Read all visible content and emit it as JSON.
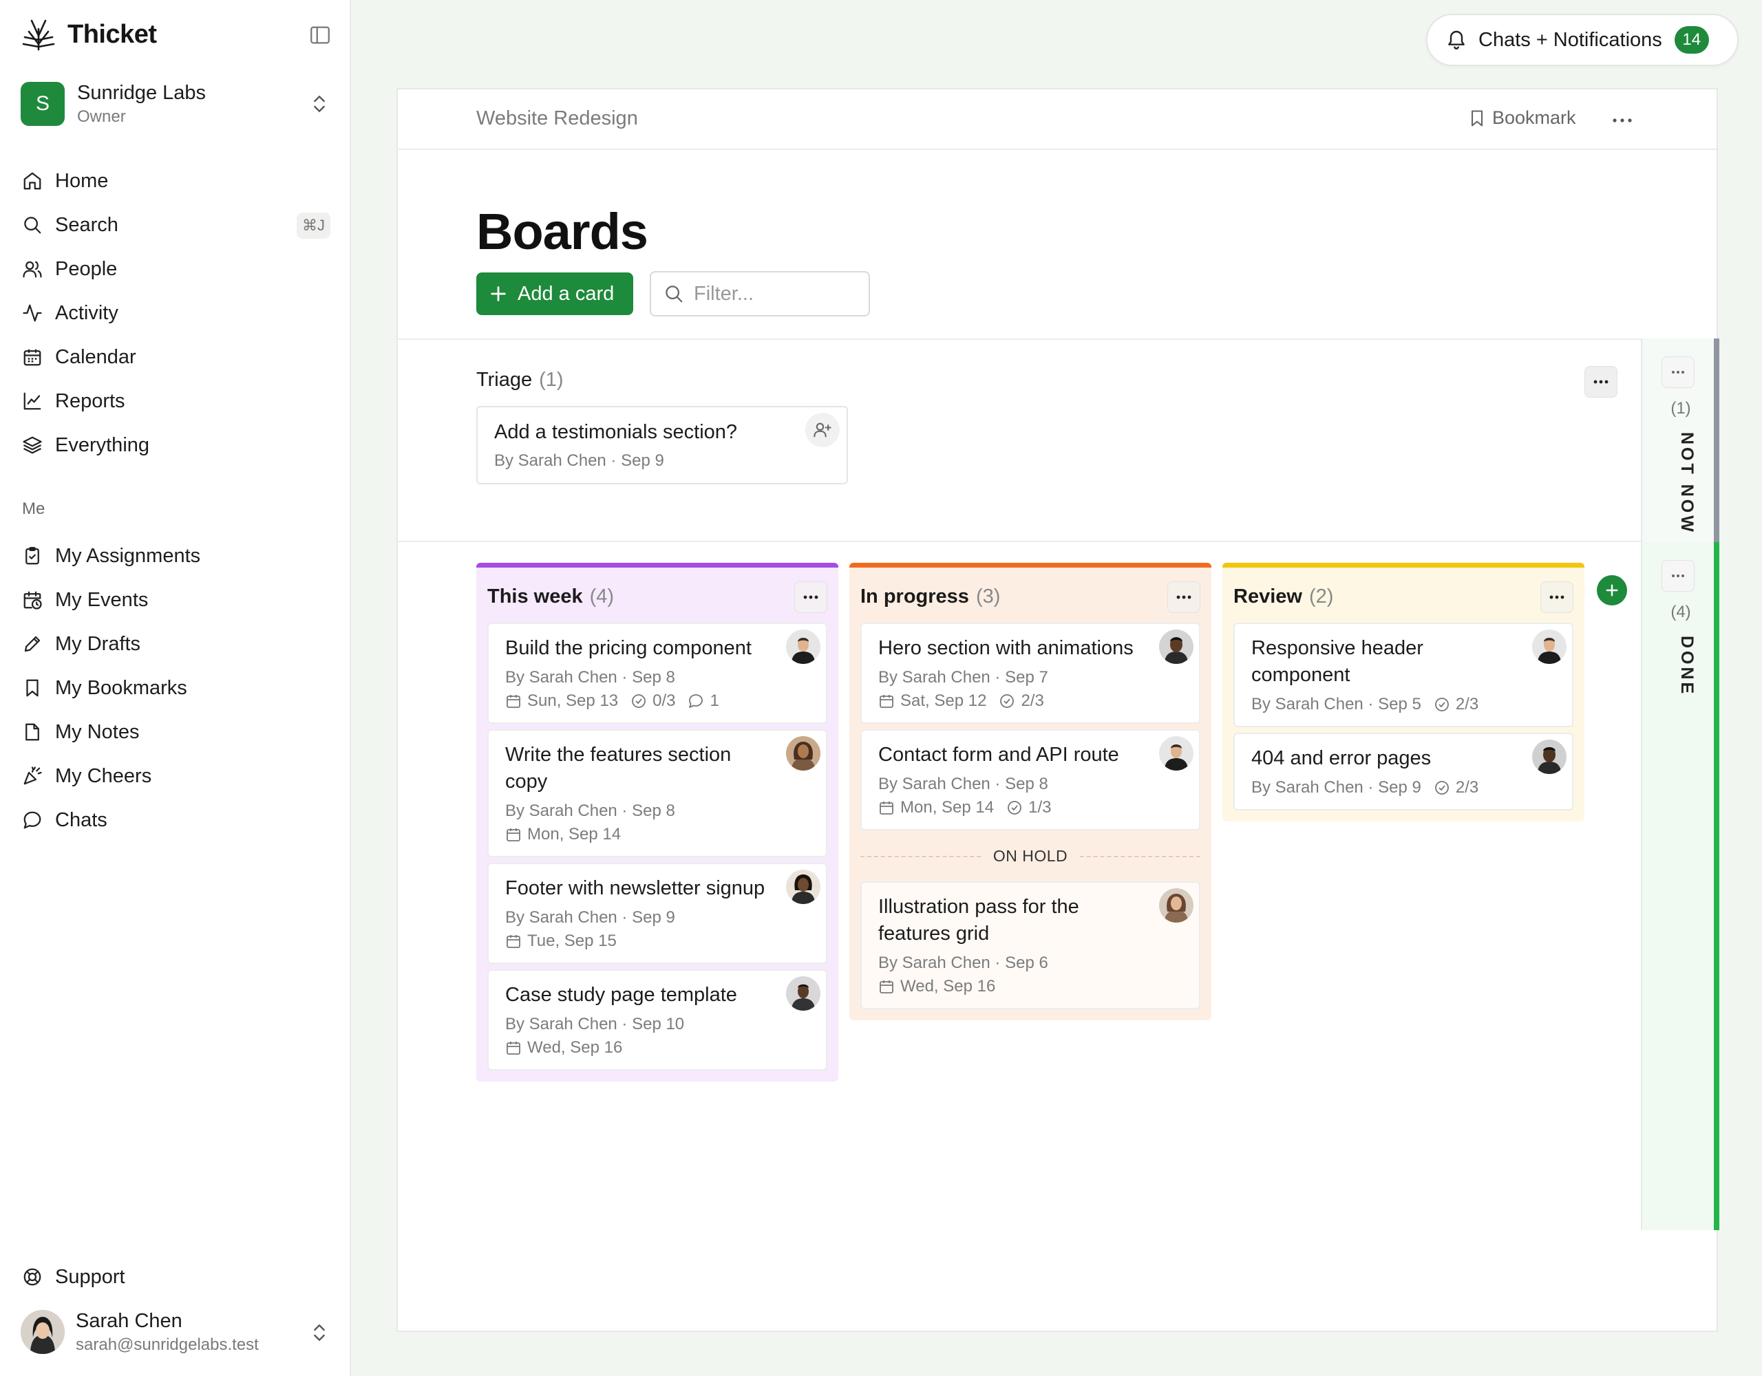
{
  "app": {
    "name": "Thicket"
  },
  "org": {
    "name": "Sunridge Labs",
    "role": "Owner",
    "initial": "S"
  },
  "nav": {
    "main": [
      {
        "label": "Home",
        "icon": "home-icon"
      },
      {
        "label": "Search",
        "icon": "search-icon",
        "shortcut": "⌘J"
      },
      {
        "label": "People",
        "icon": "people-icon"
      },
      {
        "label": "Activity",
        "icon": "activity-icon"
      },
      {
        "label": "Calendar",
        "icon": "calendar-icon"
      },
      {
        "label": "Reports",
        "icon": "chart-icon"
      },
      {
        "label": "Everything",
        "icon": "layers-icon"
      }
    ],
    "me_label": "Me",
    "me": [
      {
        "label": "My Assignments",
        "icon": "clipboard-check-icon"
      },
      {
        "label": "My Events",
        "icon": "calendar-clock-icon"
      },
      {
        "label": "My Drafts",
        "icon": "pencil-icon"
      },
      {
        "label": "My Bookmarks",
        "icon": "bookmark-icon"
      },
      {
        "label": "My Notes",
        "icon": "note-icon"
      },
      {
        "label": "My Cheers",
        "icon": "party-icon"
      },
      {
        "label": "Chats",
        "icon": "chat-icon"
      }
    ],
    "support": "Support"
  },
  "user": {
    "name": "Sarah Chen",
    "email": "sarah@sunridgelabs.test"
  },
  "notifications": {
    "label": "Chats + Notifications",
    "count": "14"
  },
  "header": {
    "breadcrumb": "Website Redesign",
    "bookmark_label": "Bookmark"
  },
  "page": {
    "title": "Boards",
    "add_card_label": "Add a card",
    "filter_placeholder": "Filter..."
  },
  "triage": {
    "name": "Triage",
    "count": "(1)",
    "card": {
      "title": "Add a testimonials section?",
      "meta": "By Sarah Chen · Sep 9"
    }
  },
  "side_columns": {
    "not_now": {
      "label": "NOT NOW",
      "count": "(1)"
    },
    "done": {
      "label": "DONE",
      "count": "(4)"
    }
  },
  "columns": {
    "this_week": {
      "name": "This week",
      "count": "(4)",
      "cards": [
        {
          "title": "Build the pricing component",
          "byline": "By Sarah Chen · Sep 8",
          "due": "Sun, Sep 13",
          "steps": "0/3",
          "comments": "1"
        },
        {
          "title": "Write the features section copy",
          "byline": "By Sarah Chen · Sep 8",
          "due": "Mon, Sep 14"
        },
        {
          "title": "Footer with newsletter signup",
          "byline": "By Sarah Chen · Sep 9",
          "due": "Tue, Sep 15"
        },
        {
          "title": "Case study page template",
          "byline": "By Sarah Chen · Sep 10",
          "due": "Wed, Sep 16"
        }
      ]
    },
    "in_progress": {
      "name": "In progress",
      "count": "(3)",
      "cards": [
        {
          "title": "Hero section with animations",
          "byline": "By Sarah Chen · Sep 7",
          "due": "Sat, Sep 12",
          "steps": "2/3"
        },
        {
          "title": "Contact form and API route",
          "byline": "By Sarah Chen · Sep 8",
          "due": "Mon, Sep 14",
          "steps": "1/3"
        }
      ],
      "on_hold_label": "ON HOLD",
      "on_hold_cards": [
        {
          "title": "Illustration pass for the features grid",
          "byline": "By Sarah Chen · Sep 6",
          "due": "Wed, Sep 16"
        }
      ]
    },
    "review": {
      "name": "Review",
      "count": "(2)",
      "cards": [
        {
          "title": "Responsive header component",
          "byline": "By Sarah Chen · Sep 5",
          "steps": "2/3"
        },
        {
          "title": "404 and error pages",
          "byline": "By Sarah Chen · Sep 9",
          "steps": "2/3"
        }
      ]
    }
  },
  "colors": {
    "brand": "#1e8a3b",
    "this_week": "#a64be3",
    "in_progress": "#f06b1f",
    "review": "#f0c60e",
    "done": "#22b64a",
    "not_now": "#8f96a0"
  }
}
